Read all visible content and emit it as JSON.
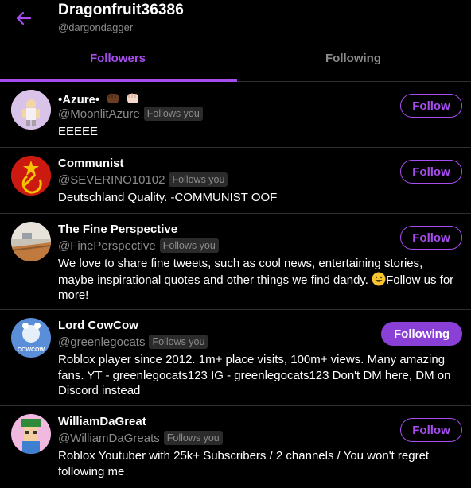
{
  "header": {
    "title": "Dragonfruit36386",
    "handle": "@dargondagger"
  },
  "tabs": [
    {
      "label": "Followers",
      "active": true
    },
    {
      "label": "Following",
      "active": false
    }
  ],
  "colors": {
    "accent": "#a74df0",
    "background": "#000000",
    "secondary_text": "#8b8b8b",
    "divider": "#2f2f2f"
  },
  "rows": [
    {
      "name": "•Azure•",
      "name_emoji": [
        "raised-fist-dark-icon",
        "raised-fist-light-icon"
      ],
      "handle": "@MoonlitAzure",
      "badge": "Follows you",
      "bio": "EEEEE",
      "button": "Follow"
    },
    {
      "name": "Communist",
      "handle": "@SEVERINO10102",
      "badge": "Follows you",
      "bio": "Deutschland Quality. -COMMUNIST OOF",
      "button": "Follow"
    },
    {
      "name": "The Fine Perspective",
      "handle": "@FinePerspective",
      "badge": "Follows you",
      "bio_before": "We love to share fine tweets, such as cool news, entertaining stories, maybe inspirational quotes and other things we find dandy. ",
      "bio_emoji": "grinning-face-icon",
      "bio_after": "Follow us for more!",
      "button": "Follow"
    },
    {
      "name": "Lord CowCow",
      "handle": "@greenlegocats",
      "badge": "Follows you",
      "bio": "Roblox player since 2012. 1m+ place visits, 100m+ views. Many amazing fans. YT - greenlegocats123 IG - greenlegocats123 Don't DM here, DM on Discord instead",
      "avatar_text": "COWCOW",
      "button": "Following"
    },
    {
      "name": "WilliamDaGreat",
      "handle": "@WilliamDaGreats",
      "badge": "Follows you",
      "bio": "Roblox Youtuber with 25k+ Subscribers / 2 channels / You won't regret following me",
      "button": "Follow"
    }
  ]
}
